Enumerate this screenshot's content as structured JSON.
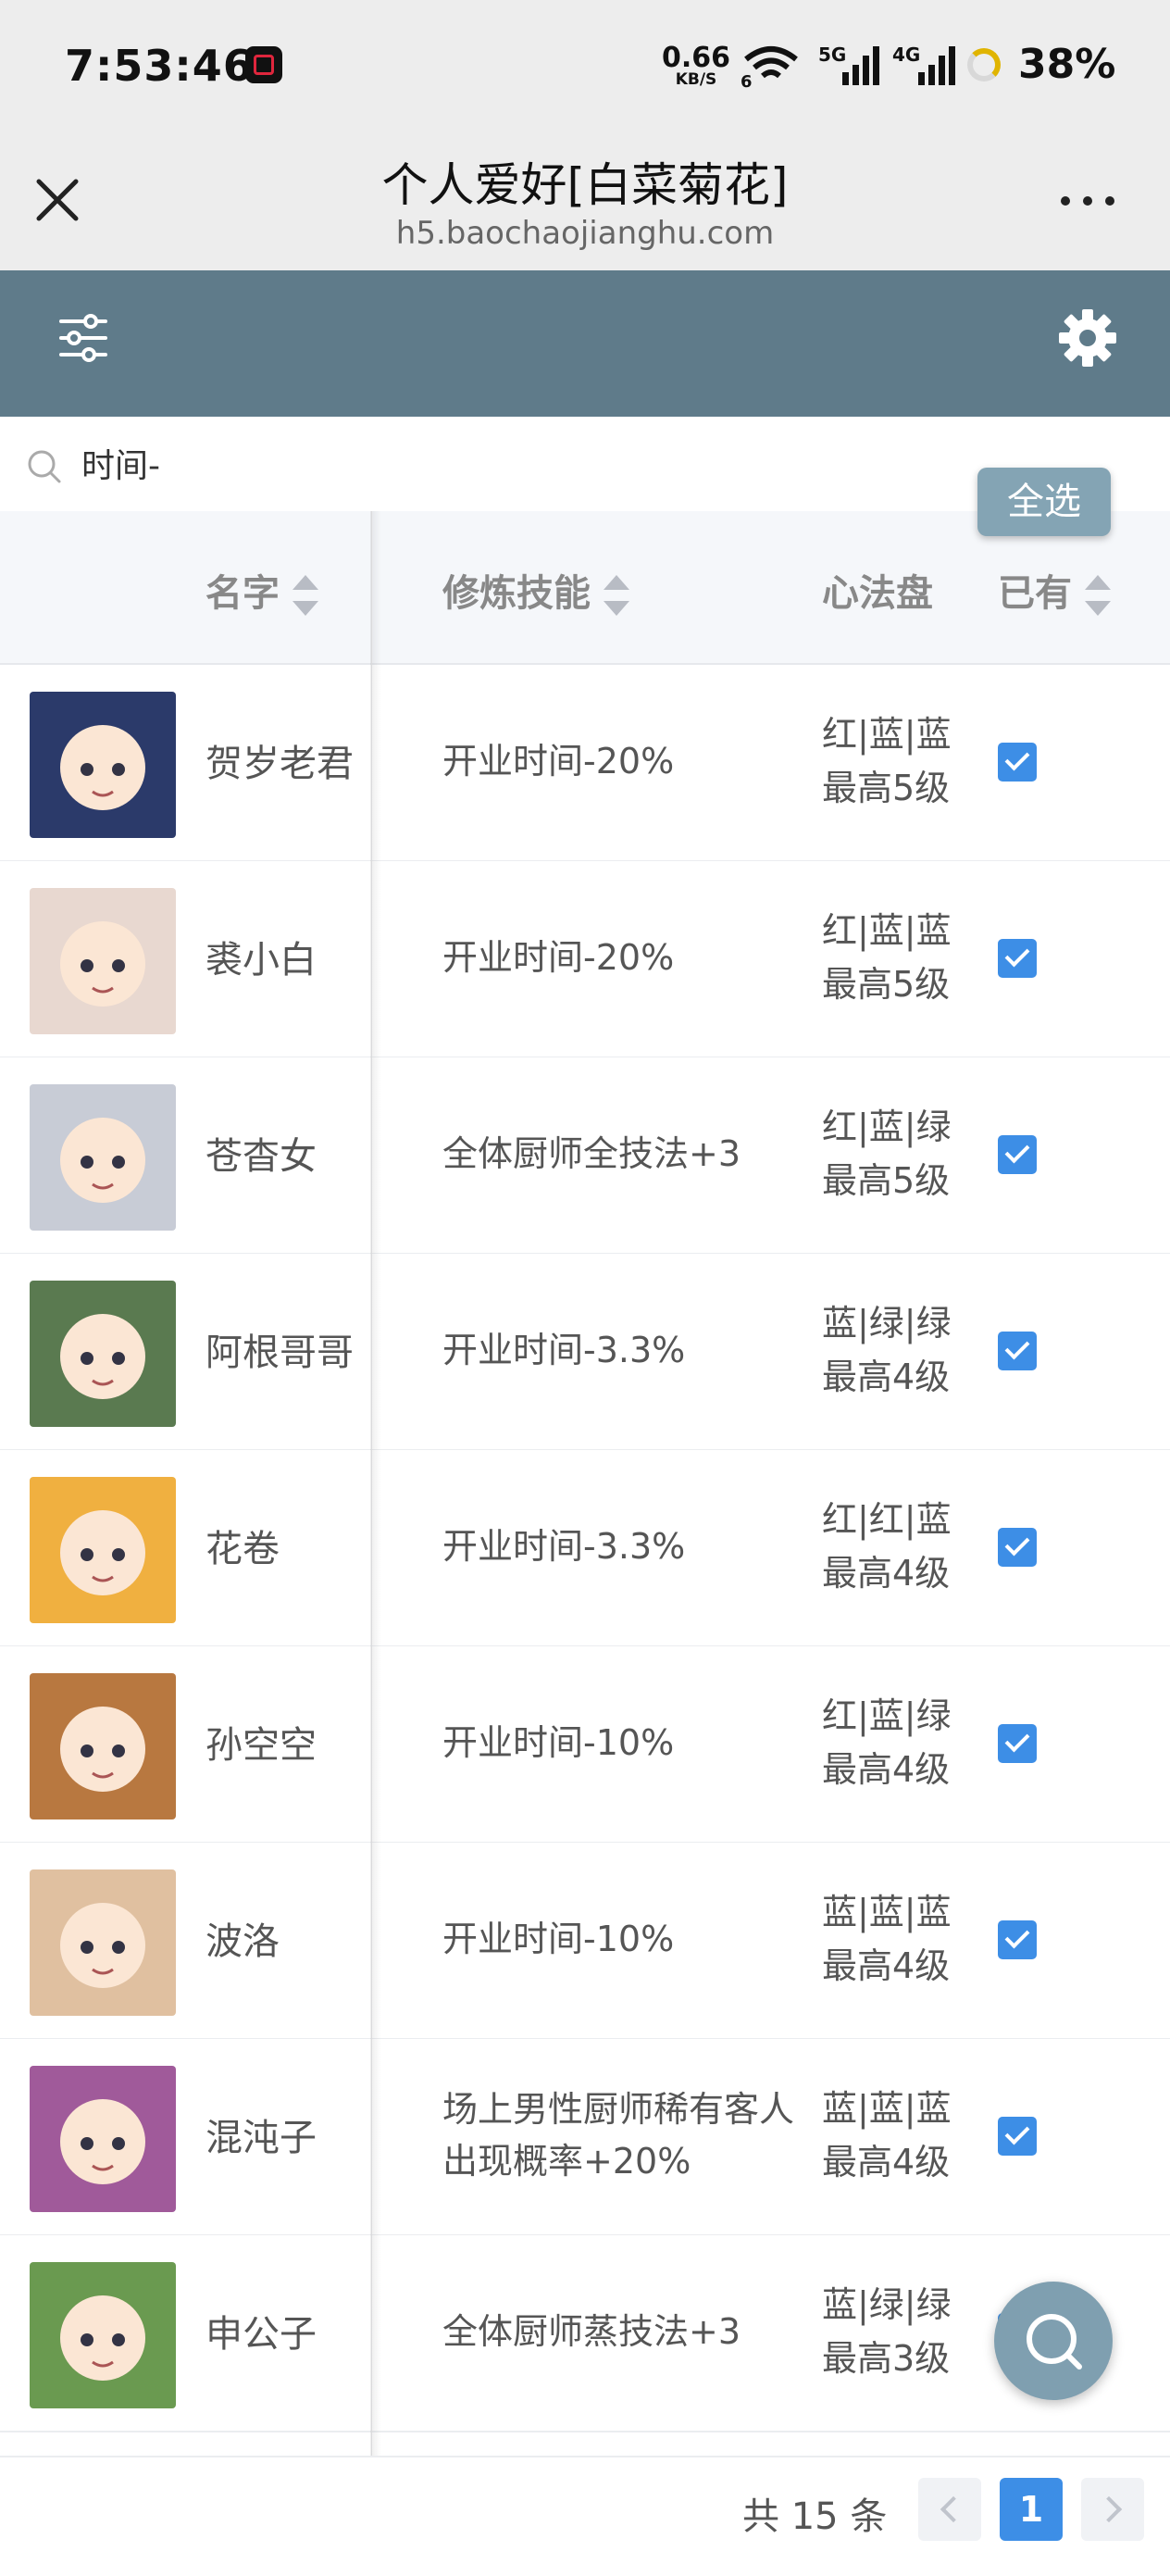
{
  "status_bar": {
    "time": "7:53:46",
    "net_speed_value": "0.66",
    "net_speed_unit": "KB/S",
    "wifi_label": "6",
    "sim1_label": "5G",
    "sim2_label": "4G",
    "battery": "38%"
  },
  "titlebar": {
    "title": "个人爱好[白菜菊花]",
    "url": "h5.baochaojianghu.com"
  },
  "search": {
    "value": "时间-"
  },
  "select_all_label": "全选",
  "table": {
    "headers": {
      "name": "名字",
      "skill": "修炼技能",
      "board": "心法盘",
      "owned": "已有"
    },
    "rows": [
      {
        "name": "贺岁老君",
        "skill": "开业时间-20%",
        "board_colors": "红|蓝|蓝",
        "board_level": "最高5级",
        "owned": true,
        "avatar_color": "#2b3a6a"
      },
      {
        "name": "裘小白",
        "skill": "开业时间-20%",
        "board_colors": "红|蓝|蓝",
        "board_level": "最高5级",
        "owned": true,
        "avatar_color": "#e8d8d0"
      },
      {
        "name": "苍杳女",
        "skill": "全体厨师全技法+3",
        "board_colors": "红|蓝|绿",
        "board_level": "最高5级",
        "owned": true,
        "avatar_color": "#c8ccd6"
      },
      {
        "name": "阿根哥哥",
        "skill": "开业时间-3.3%",
        "board_colors": "蓝|绿|绿",
        "board_level": "最高4级",
        "owned": true,
        "avatar_color": "#5a7a50"
      },
      {
        "name": "花卷",
        "skill": "开业时间-3.3%",
        "board_colors": "红|红|蓝",
        "board_level": "最高4级",
        "owned": true,
        "avatar_color": "#f0b040"
      },
      {
        "name": "孙空空",
        "skill": "开业时间-10%",
        "board_colors": "红|蓝|绿",
        "board_level": "最高4级",
        "owned": true,
        "avatar_color": "#b87840"
      },
      {
        "name": "波洛",
        "skill": "开业时间-10%",
        "board_colors": "蓝|蓝|蓝",
        "board_level": "最高4级",
        "owned": true,
        "avatar_color": "#e0c0a0"
      },
      {
        "name": "混沌子",
        "skill": "场上男性厨师稀有客人出现概率+20%",
        "board_colors": "蓝|蓝|蓝",
        "board_level": "最高4级",
        "owned": true,
        "avatar_color": "#a05a9a"
      },
      {
        "name": "申公子",
        "skill": "全体厨师蒸技法+3",
        "board_colors": "蓝|绿|绿",
        "board_level": "最高3级",
        "owned": true,
        "avatar_color": "#6a9a50"
      }
    ]
  },
  "pagination": {
    "total": "共 15 条",
    "current_page": "1"
  }
}
